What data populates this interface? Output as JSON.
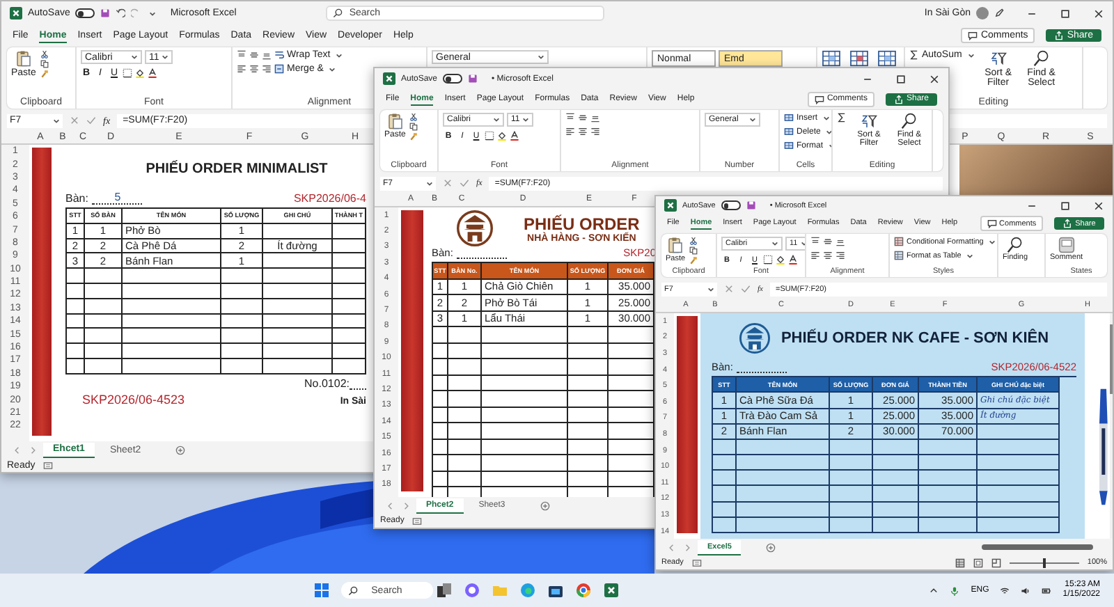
{
  "windows": [
    {
      "kind": "minimalist",
      "autosave": "AutoSave",
      "autosave_on": false,
      "title": "Microsoft Excel",
      "search": {
        "placeholder": "Search"
      },
      "user": "In Sài Gòn",
      "tabs": [
        {
          "label": "File",
          "selected": false
        },
        {
          "label": "Home",
          "selected": true
        },
        {
          "label": "Insert",
          "selected": false
        },
        {
          "label": "Page Layout",
          "selected": false
        },
        {
          "label": "Formulas",
          "selected": false
        },
        {
          "label": "Data",
          "selected": false
        },
        {
          "label": "Review",
          "selected": false
        },
        {
          "label": "View",
          "selected": false
        },
        {
          "label": "Developer",
          "selected": false
        },
        {
          "label": "Help",
          "selected": false
        }
      ],
      "comments": "Comments",
      "share": "Share",
      "ribbon": [
        {
          "label": "Clipboard",
          "controls": [
            {
              "kind": "paste",
              "label": "Paste"
            }
          ]
        },
        {
          "label": "Font",
          "controls": [
            {
              "kind": "font",
              "label": "Calibri"
            },
            {
              "kind": "size",
              "label": "11"
            },
            {
              "kind": "bold",
              "label": "B"
            },
            {
              "kind": "italic",
              "label": "I"
            },
            {
              "kind": "underline",
              "label": "U"
            }
          ]
        },
        {
          "label": "Alignment",
          "controls": [
            {
              "kind": "align-vertical"
            },
            {
              "kind": "wrap",
              "label": "Wrap Text"
            },
            {
              "kind": "align-horizontal"
            },
            {
              "kind": "merge",
              "label": "Merge &"
            }
          ]
        },
        {
          "controls": [
            {
              "kind": "number-format",
              "label": "General"
            }
          ]
        },
        {
          "controls": [
            {
              "kind": "style",
              "label": "Nonmal"
            },
            {
              "kind": "style-accent",
              "label": "Emd"
            }
          ]
        },
        {
          "controls": [
            {
              "kind": "cells"
            }
          ]
        },
        {
          "label": "Editing",
          "controls": [
            {
              "kind": "sum",
              "label": "AutoSum"
            },
            {
              "kind": "sort",
              "label": "Sort & Filter"
            },
            {
              "kind": "find",
              "label": "Find & Select"
            }
          ]
        }
      ],
      "name_box": "F7",
      "function_button": "fx",
      "formula": "=SUM(F7:F20)",
      "columns": [
        "A",
        "B",
        "C",
        "D",
        "E",
        "F",
        "G",
        "H",
        "P",
        "Q",
        "R",
        "S"
      ],
      "row_numbers": [
        "1",
        "2",
        "3",
        "4",
        "5",
        "6",
        "7",
        "8",
        "9",
        "10",
        "11",
        "12",
        "13",
        "14",
        "15",
        "16",
        "17",
        "18",
        "19",
        "20",
        "21",
        "22"
      ],
      "sheet": {
        "title": "PHIẾU ORDER MINIMALIST",
        "table_label": "Bàn:",
        "table_value": "5",
        "code": "SKP2026/06-4",
        "headers": [
          "STT",
          "SỐ BÀN",
          "TÊN MÓN",
          "SỐ LƯỢNG",
          "GHI CHÚ",
          "THÀNH T"
        ],
        "rows": [
          [
            "1",
            "1",
            "Phở Bò",
            "1",
            null,
            null
          ],
          [
            "2",
            "2",
            "Cà Phê Dá",
            "2",
            "Ít đường",
            null
          ],
          [
            "3",
            "2",
            "Bánh Flan",
            "1",
            null,
            null
          ]
        ],
        "footer": {
          "number": "No.0102:",
          "code": "SKP2026/06-4523",
          "brand": "In Sài"
        }
      },
      "sheet_tabs": [
        {
          "label": "Ehcet1",
          "selected": true
        },
        {
          "label": "Sheet2",
          "selected": false
        }
      ],
      "status": "Ready"
    },
    {
      "kind": "restaurant",
      "autosave": "AutoSave",
      "autosave_on": false,
      "title": "• Microsoft Excel",
      "tabs": [
        {
          "label": "File",
          "selected": false
        },
        {
          "label": "Home",
          "selected": true
        },
        {
          "label": "Insert",
          "selected": false
        },
        {
          "label": "Page Layout",
          "selected": false
        },
        {
          "label": "Formulas",
          "selected": false
        },
        {
          "label": "Data",
          "selected": false
        },
        {
          "label": "Review",
          "selected": false
        },
        {
          "label": "View",
          "selected": false
        },
        {
          "label": "Help",
          "selected": false
        }
      ],
      "comments": "Comments",
      "share": "Share",
      "ribbon": [
        {
          "label": "Clipboard",
          "controls": [
            {
              "kind": "paste",
              "label": "Paste"
            }
          ]
        },
        {
          "label": "Font",
          "controls": [
            {
              "kind": "font",
              "label": "Calibri"
            },
            {
              "kind": "size",
              "label": "11"
            },
            {
              "kind": "bold",
              "label": "B"
            },
            {
              "kind": "italic",
              "label": "I"
            },
            {
              "kind": "underline",
              "label": "U"
            }
          ]
        },
        {
          "label": "Alignment",
          "controls": [
            {
              "kind": "align-vertical"
            },
            {
              "kind": "align-horizontal"
            }
          ]
        },
        {
          "label": "Number",
          "controls": [
            {
              "kind": "number-format",
              "label": "General"
            }
          ]
        },
        {
          "label": "Cells",
          "controls": [
            {
              "kind": "insert",
              "label": "Insert"
            },
            {
              "kind": "delete",
              "label": "Delete"
            },
            {
              "kind": "format",
              "label": "Format"
            }
          ]
        },
        {
          "label": "Editing",
          "controls": [
            {
              "kind": "sum"
            },
            {
              "kind": "sort",
              "label": "Sort & Filter"
            },
            {
              "kind": "find",
              "label": "Find & Select"
            }
          ]
        }
      ],
      "name_box": "F7",
      "function_button": "fx",
      "formula": "=SUM(F7:F20)",
      "columns": [
        "A",
        "B",
        "C",
        "D",
        "E",
        "F"
      ],
      "row_numbers": [
        "1",
        "2",
        "3",
        "3",
        "4",
        "6",
        "7",
        "8",
        "9",
        "10",
        "11",
        "12",
        "13",
        "14",
        "15",
        "16",
        "17",
        "18"
      ],
      "sheet": {
        "title": "PHIẾU ORDER",
        "subtitle": "NHÀ HÀNG - SƠN KIẾN",
        "table_label": "Bàn:",
        "code": "SKP20",
        "headers": [
          "STT",
          "BÀN No.",
          "TÊN MÓN",
          "SỐ LƯỢNG",
          "ĐƠN GIÁ"
        ],
        "rows": [
          [
            "1",
            "1",
            "Chả Giò Chiên",
            "1",
            "35.000"
          ],
          [
            "2",
            "2",
            "Phở Bò Tái",
            "1",
            "25.000"
          ],
          [
            "3",
            "1",
            "Lẩu Thái",
            "1",
            "30.000"
          ]
        ]
      },
      "sheet_tabs": [
        {
          "label": "Phcet2",
          "selected": true
        },
        {
          "label": "Sheet3",
          "selected": false
        }
      ],
      "status": "Ready"
    },
    {
      "kind": "cafe",
      "autosave": "AutoSave",
      "autosave_on": false,
      "title": "• Microsoft Excel",
      "tabs": [
        {
          "label": "File",
          "selected": false
        },
        {
          "label": "Home",
          "selected": true
        },
        {
          "label": "Insert",
          "selected": false
        },
        {
          "label": "Page Layout",
          "selected": false
        },
        {
          "label": "Formulas",
          "selected": false
        },
        {
          "label": "Data",
          "selected": false
        },
        {
          "label": "Review",
          "selected": false
        },
        {
          "label": "View",
          "selected": false
        },
        {
          "label": "Help",
          "selected": false
        }
      ],
      "comments": "Comments",
      "share": "Share",
      "ribbon": [
        {
          "label": "Clipboard",
          "controls": [
            {
              "kind": "paste",
              "label": "Paste"
            }
          ]
        },
        {
          "label": "Font",
          "controls": [
            {
              "kind": "font",
              "label": "Calibri"
            },
            {
              "kind": "size",
              "label": "11"
            },
            {
              "kind": "bold",
              "label": "B"
            },
            {
              "kind": "italic",
              "label": "I"
            },
            {
              "kind": "underline",
              "label": "U"
            }
          ]
        },
        {
          "label": "Alignment",
          "controls": [
            {
              "kind": "align-vertical"
            },
            {
              "kind": "align-horizontal"
            }
          ]
        },
        {
          "label": "Styles",
          "controls": [
            {
              "kind": "conditional",
              "label": "Conditional Formatting"
            },
            {
              "kind": "table-format",
              "label": "Format as Table"
            }
          ]
        },
        {
          "controls": [
            {
              "kind": "find",
              "label": "Finding"
            }
          ]
        },
        {
          "label": "States",
          "controls": [
            {
              "kind": "comment",
              "label": "Somment"
            }
          ]
        }
      ],
      "name_box": "F7",
      "function_button": "fx",
      "formula": "=SUM(F7:F20)",
      "columns": [
        "A",
        "B",
        "C",
        "D",
        "E",
        "F",
        "G",
        "H"
      ],
      "row_numbers": [
        "1",
        "2",
        "3",
        "4",
        "5",
        "6",
        "7",
        "8",
        "9",
        "10",
        "11",
        "12",
        "13",
        "14"
      ],
      "sheet": {
        "title": "PHIẾU ORDER NK CAFE - SƠN KIÊN",
        "table_label": "Bàn:",
        "code": "SKP2026/06-4522",
        "headers": [
          "STT",
          "TÊN MÓN",
          "SỐ LƯỢNG",
          "ĐƠN GIÁ",
          "THÀNH TIỀN",
          "GHI CHÚ đặc biệt"
        ],
        "rows": [
          [
            "1",
            "Cà Phê Sữa Đá",
            "1",
            "25.000",
            "35.000",
            "Ghi chú đặc biệt"
          ],
          [
            "1",
            "Trà Đào Cam Sả",
            "1",
            "25.000",
            "35.000",
            "Ít đường"
          ],
          [
            "2",
            "Bánh Flan",
            "2",
            "30.000",
            "70.000",
            null
          ]
        ]
      },
      "sheet_tabs": [
        {
          "label": "Excel5",
          "selected": true
        }
      ],
      "status": "Ready",
      "zoom": {
        "level": 0.5,
        "reading": "100%"
      }
    }
  ],
  "taskbar": {
    "search": {
      "placeholder": "Search"
    },
    "language": "ENG",
    "time": "15:23 AM",
    "date": "1/15/2022"
  }
}
